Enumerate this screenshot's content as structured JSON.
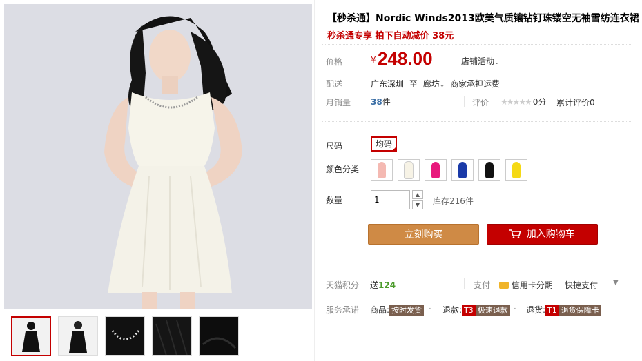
{
  "product": {
    "title": "【秒杀通】Nordic Winds2013欧美气质镶钻钉珠镂空无袖雪纺连衣裙",
    "promo_prefix": "秒杀通专享",
    "promo_text": "拍下自动减价 38元"
  },
  "price": {
    "label": "价格",
    "currency": "¥",
    "value": "248.00",
    "store_activity": "店铺活动"
  },
  "shipping": {
    "label": "配送",
    "from": "广东深圳",
    "to_word": "至",
    "to": "廊坊",
    "fee": "商家承担运费"
  },
  "sales": {
    "label": "月销量",
    "count": "38",
    "unit": "件",
    "rating_label": "评价",
    "score": "0分",
    "reviews": "累计评价0"
  },
  "options": {
    "size_label": "尺码",
    "size_value": "均码",
    "color_label": "颜色分类",
    "colors": [
      "#f4b9b2",
      "#f7f3e6",
      "#e8187c",
      "#1a3aa8",
      "#111111",
      "#f5d915"
    ],
    "qty_label": "数量",
    "qty_value": "1",
    "stock": "库存216件"
  },
  "buttons": {
    "buy_now": "立刻购买",
    "add_cart": "加入购物车"
  },
  "points": {
    "label": "天猫积分",
    "prefix": "送",
    "value": "124",
    "pay_label": "支付",
    "credit": "信用卡分期",
    "quick": "快捷支付"
  },
  "service": {
    "label": "服务承诺",
    "goods": "商品:",
    "goods_tag": "按时发货",
    "refund": "退款:",
    "refund_code": "T3",
    "refund_tag": "极速退款",
    "return": "退货:",
    "return_code": "T1",
    "return_tag": "退货保障卡"
  }
}
